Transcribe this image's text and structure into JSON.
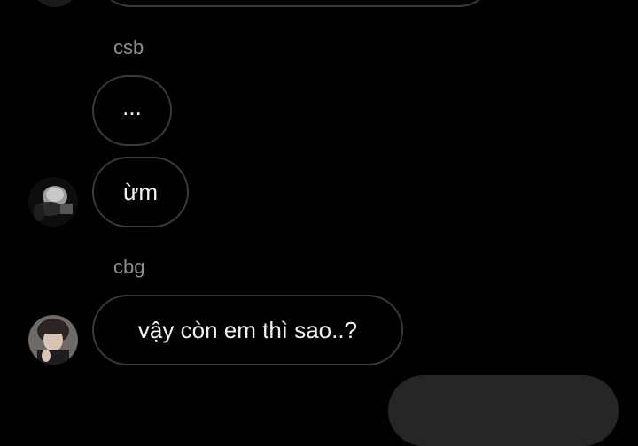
{
  "messages": [
    {
      "sender": "csb",
      "text": "..."
    },
    {
      "sender": "csb",
      "text": "ừm"
    },
    {
      "sender": "cbg",
      "text": "vậy còn em thì sao..?"
    }
  ],
  "colors": {
    "background": "#000000",
    "bubble_border": "#3a3a3a",
    "sender_name": "#8e8e8e",
    "message_text": "#f2f2f2"
  }
}
